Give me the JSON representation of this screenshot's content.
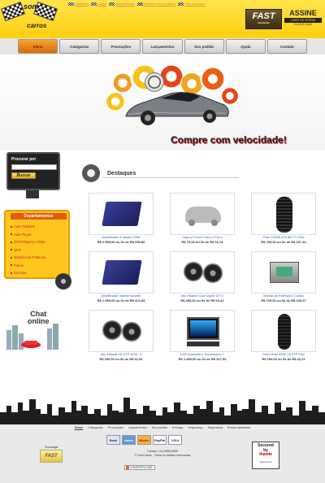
{
  "header": {
    "logo_top": "som",
    "logo_bottom": "carros",
    "top_links": [
      "Cadastro",
      "Login",
      "Minha conta",
      "Histórico de pedidos",
      "Fale conosco"
    ],
    "fast_title": "FAST",
    "fast_sub": "accelerate",
    "assine_title": "ASSINE",
    "assine_button": "LIVRO DE VISITAS",
    "assine_link": "CLIQUE AQUI"
  },
  "nav": {
    "items": [
      "Início",
      "Categorias",
      "Promoções",
      "Lançamentos",
      "Seu pedido",
      "Ajuda",
      "Contato"
    ],
    "active_index": 0
  },
  "banner": {
    "slogan": "Compre com velocidade!"
  },
  "sidebar": {
    "search_label": "Procurar por",
    "search_placeholder": "",
    "search_button": "Buscar",
    "departments_title": "Departamentos",
    "departments": [
      "Auto Falantes",
      "Auto Peças",
      "DVD Players e Telas",
      "GPS",
      "Módulos de Potência",
      "Pneus",
      "Sonotas"
    ],
    "chat_title_1": "Chat",
    "chat_title_2": "online"
  },
  "content": {
    "section_title": "Destaques",
    "products": [
      {
        "name": "Amplificador 4 canais 125W",
        "price": "R$ 2.999,00 ou 5x de R$ 659,80",
        "icon": "amplifier-icon"
      },
      {
        "name": "Capa p/ Cobrir Carro c/ Forro",
        "price": "R$ 79,00 ou 5x de R$ 16,78",
        "icon": "car-cover-icon"
      },
      {
        "name": "Pneu 195/55 R15 85V TL Pilot",
        "price": "R$ 789,00 ou 5x de R$ 167,34",
        "icon": "tire-icon"
      },
      {
        "name": "Amplificador Valente Booster",
        "price": "R$ 1.999,00 ou 5x de R$ 423,99",
        "icon": "amplifier-icon"
      },
      {
        "name": "Alto-Falante Coax Duplo 10\" G",
        "price": "R$ 290,00 ou 5x de R$ 63,42",
        "icon": "speaker-icon"
      },
      {
        "name": "Módulo de Potência 2 Canais",
        "price": "R$ 709,00 ou 5x de R$ 169,47",
        "icon": "module-icon"
      },
      {
        "name": "Alto-Falante XS GTP 1025 - 3",
        "price": "R$ 290,00 ou 5x de R$ 61,51",
        "icon": "speaker-icon"
      },
      {
        "name": "DVD Automotivo Touchscreen 7",
        "price": "R$ 1.499,00 ou 5x de R$ 317,93",
        "icon": "dvd-icon"
      },
      {
        "name": "Pneu Moto 90/90-18 STP Pilot",
        "price": "R$ 199,00 ou 5x de R$ 42,21",
        "icon": "moto-tire-icon"
      }
    ]
  },
  "footer": {
    "links": [
      "Home",
      "Categorias",
      "Promoções",
      "Lançamentos",
      "Seu pedido",
      "Entrega",
      "Segurança",
      "Segurança",
      "Busca detalhada"
    ],
    "active_index": 0,
    "tech_label": "Tecnologia",
    "tech_logo": "FAST",
    "cards": [
      "Bank",
      "Amex",
      "Master",
      "PayPal",
      "VISA"
    ],
    "copy_line_1": "Contato: (11) 5555-5555",
    "copy_line_2": "© SomCarros - Todos os direitos reservados",
    "share_label": "COMPARTILHAR",
    "secured_1": "Secured",
    "secured_2": "by",
    "secured_3": "thawte",
    "secured_num": "0000-00-00"
  },
  "colors": {
    "header_yellow": "#ffd62a",
    "nav_active": "#e07410",
    "dept_bg": "#ffc61d",
    "dept_header": "#e55b0d",
    "link_blue": "#2b5cab"
  }
}
